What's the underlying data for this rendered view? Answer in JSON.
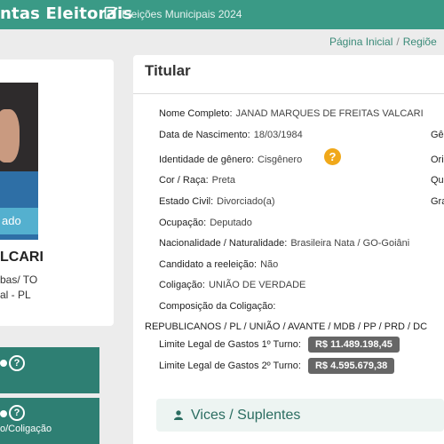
{
  "header": {
    "app_title": "ntas Eleitorais",
    "election": "Eleições Municipais 2024",
    "edit_icon": "edit-icon"
  },
  "breadcrumb": {
    "home": "Página Inicial",
    "separator": "/",
    "current": "Regiõe"
  },
  "left_panel": {
    "photo_badge": "ado",
    "name": "LCARI",
    "line1": "bas/ TO",
    "line2": "al - PL",
    "box1": {
      "help_icon": "question-circle-icon"
    },
    "box2": {
      "help_icon": "question-circle-icon",
      "subtitle": "o/Coligação"
    }
  },
  "titular": {
    "title": "Titular",
    "fields": [
      {
        "label": "Nome Completo:",
        "value": "JANAD MARQUES DE FREITAS VALCARI"
      },
      {
        "label": "Data de Nascimento:",
        "value": "18/03/1984"
      },
      {
        "label": "Identidade de gênero:",
        "value": "Cisgênero"
      },
      {
        "label": "Cor / Raça:",
        "value": "Preta"
      },
      {
        "label": "Estado Civil:",
        "value": "Divorciado(a)"
      },
      {
        "label": "Ocupação:",
        "value": "Deputado"
      },
      {
        "label": "Nacionalidade / Naturalidade:",
        "value": "Brasileira Nata / GO-Goiâni"
      },
      {
        "label": "Candidato a reeleição:",
        "value": "Não"
      },
      {
        "label": "Coligação:",
        "value": "UNIÃO DE VERDADE"
      },
      {
        "label": "Composição da Coligação:",
        "value": ""
      }
    ],
    "right_cut_labels": [
      "Gê",
      "Ori",
      "Qu",
      "Gra"
    ],
    "composicao": "REPUBLICANOS / PL / UNIÃO / AVANTE / MDB / PP / PRD / DC",
    "limite1": {
      "label": "Limite Legal de Gastos 1º Turno:",
      "value": "R$ 11.489.198,45"
    },
    "limite2": {
      "label": "Limite Legal de Gastos 2º Turno:",
      "value": "R$ 4.595.679,38"
    },
    "gender_help_icon": "question-icon"
  },
  "vices": {
    "label": "Vices / Suplentes",
    "icon": "user-icon"
  },
  "colors": {
    "header": "#3a9a86",
    "teal_box": "#2e7f73",
    "accent_orange": "#f0a81a",
    "badge": "#666666"
  }
}
